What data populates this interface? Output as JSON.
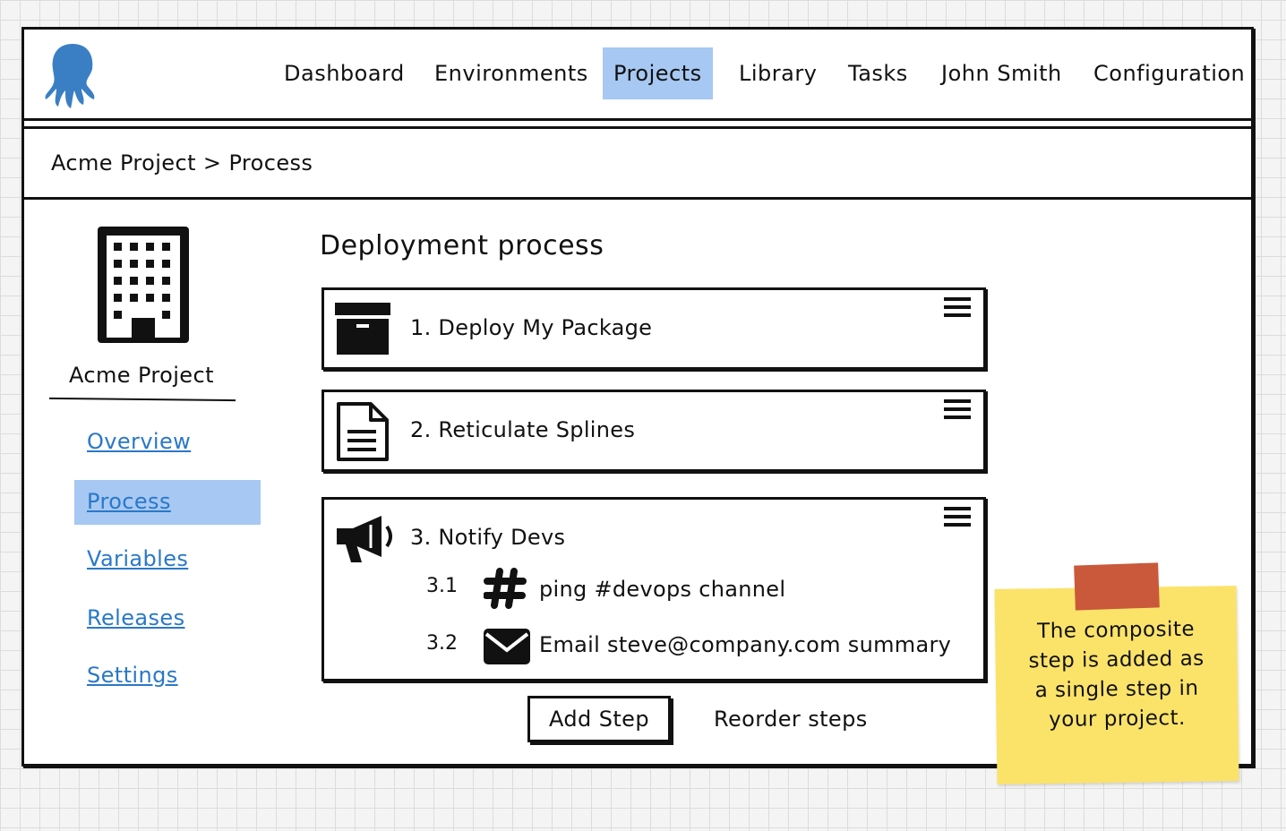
{
  "header": {
    "logo": "octopus-logo",
    "nav": [
      {
        "label": "Dashboard",
        "active": false
      },
      {
        "label": "Environments",
        "active": false
      },
      {
        "label": "Projects",
        "active": true
      },
      {
        "label": "Library",
        "active": false
      },
      {
        "label": "Tasks",
        "active": false
      },
      {
        "label": "John Smith",
        "active": false
      },
      {
        "label": "Configuration",
        "active": false
      }
    ]
  },
  "breadcrumb": "Acme Project > Process",
  "sidebar": {
    "icon": "building-icon",
    "project_name": "Acme Project",
    "items": [
      {
        "label": "Overview",
        "active": false
      },
      {
        "label": "Process",
        "active": true
      },
      {
        "label": "Variables",
        "active": false
      },
      {
        "label": "Releases",
        "active": false
      },
      {
        "label": "Settings",
        "active": false
      }
    ]
  },
  "main": {
    "heading": "Deployment process",
    "steps": [
      {
        "title": "1. Deploy My Package",
        "icon": "archive-icon"
      },
      {
        "title": "2. Reticulate Splines",
        "icon": "document-icon"
      },
      {
        "title": "3. Notify Devs",
        "icon": "megaphone-icon",
        "substeps": [
          {
            "number": "3.1",
            "icon": "hashtag-icon",
            "text": "ping #devops channel"
          },
          {
            "number": "3.2",
            "icon": "envelope-icon",
            "text": "Email steve@company.com summary"
          }
        ]
      }
    ],
    "add_step_label": "Add Step",
    "reorder_label": "Reorder steps"
  },
  "note": {
    "lines": [
      "The composite",
      "step is added as",
      "a single step in",
      "your project."
    ],
    "color": "#fbe36a",
    "tape_color": "#c9593a"
  },
  "colors": {
    "active_highlight": "#a6c8f2",
    "link": "#2a78c8"
  }
}
